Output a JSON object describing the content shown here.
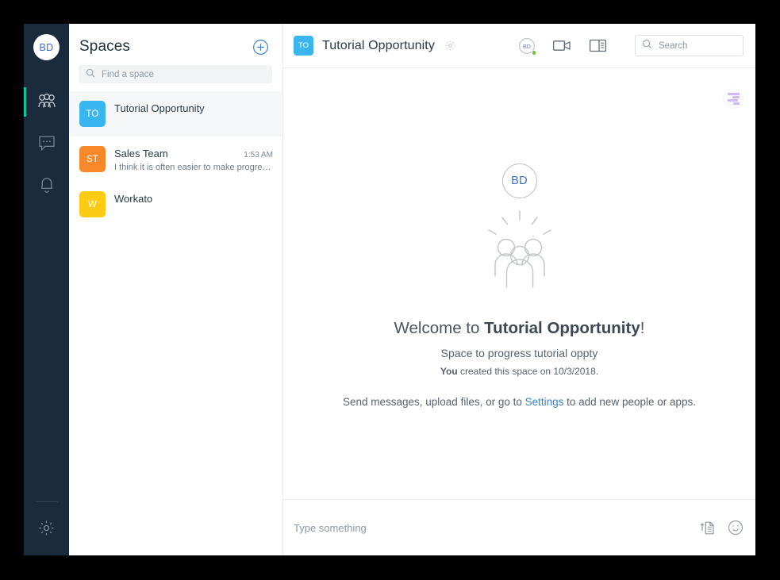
{
  "rail": {
    "avatar_initials": "BD",
    "items": [
      {
        "name": "spaces",
        "label": "Spaces",
        "active": true
      },
      {
        "name": "messages",
        "label": "Messages",
        "active": false
      },
      {
        "name": "notifications",
        "label": "Notifications",
        "active": false
      }
    ],
    "settings_label": "Settings",
    "active_indicator_color": "#0fc6a4",
    "background_color": "#1b2b3e"
  },
  "sidebar": {
    "title": "Spaces",
    "add_button_label": "+",
    "search": {
      "placeholder": "Find a space",
      "value": ""
    },
    "spaces": [
      {
        "initials": "TO",
        "name": "Tutorial Opportunity",
        "preview": "",
        "time": "",
        "color": "#39b6f0",
        "selected": true
      },
      {
        "initials": "ST",
        "name": "Sales Team",
        "preview": "I think it is often easier to make progress …",
        "time": "1:53 AM",
        "color": "#f7892b",
        "selected": false
      },
      {
        "initials": "W",
        "name": "Workato",
        "preview": "",
        "time": "",
        "color": "#fdcb14",
        "selected": false
      }
    ]
  },
  "header": {
    "space_initials": "TO",
    "space_initials_color": "#39b6f0",
    "title": "Tutorial Opportunity",
    "settings_icon": "gear-icon",
    "presence_initials": "BD",
    "presence_status_color": "#77c043",
    "call_icon": "video-camera-icon",
    "panel_icon": "sidebar-toggle-icon",
    "search": {
      "placeholder": "Search",
      "value": ""
    }
  },
  "welcome": {
    "avatar_initials": "BD",
    "heading_prefix": "Welcome to ",
    "heading_space": "Tutorial Opportunity",
    "heading_suffix": "!",
    "subtitle": "Space to progress tutorial oppty",
    "meta_you": "You",
    "meta_rest": " created this space on 10/3/2018.",
    "cta_prefix": "Send messages, upload files, or go to ",
    "cta_link": "Settings",
    "cta_suffix": " to add new people or apps."
  },
  "composer": {
    "placeholder": "Type something",
    "value": "",
    "attach_icon": "file-upload-icon",
    "emoji_icon": "smiley-icon"
  }
}
